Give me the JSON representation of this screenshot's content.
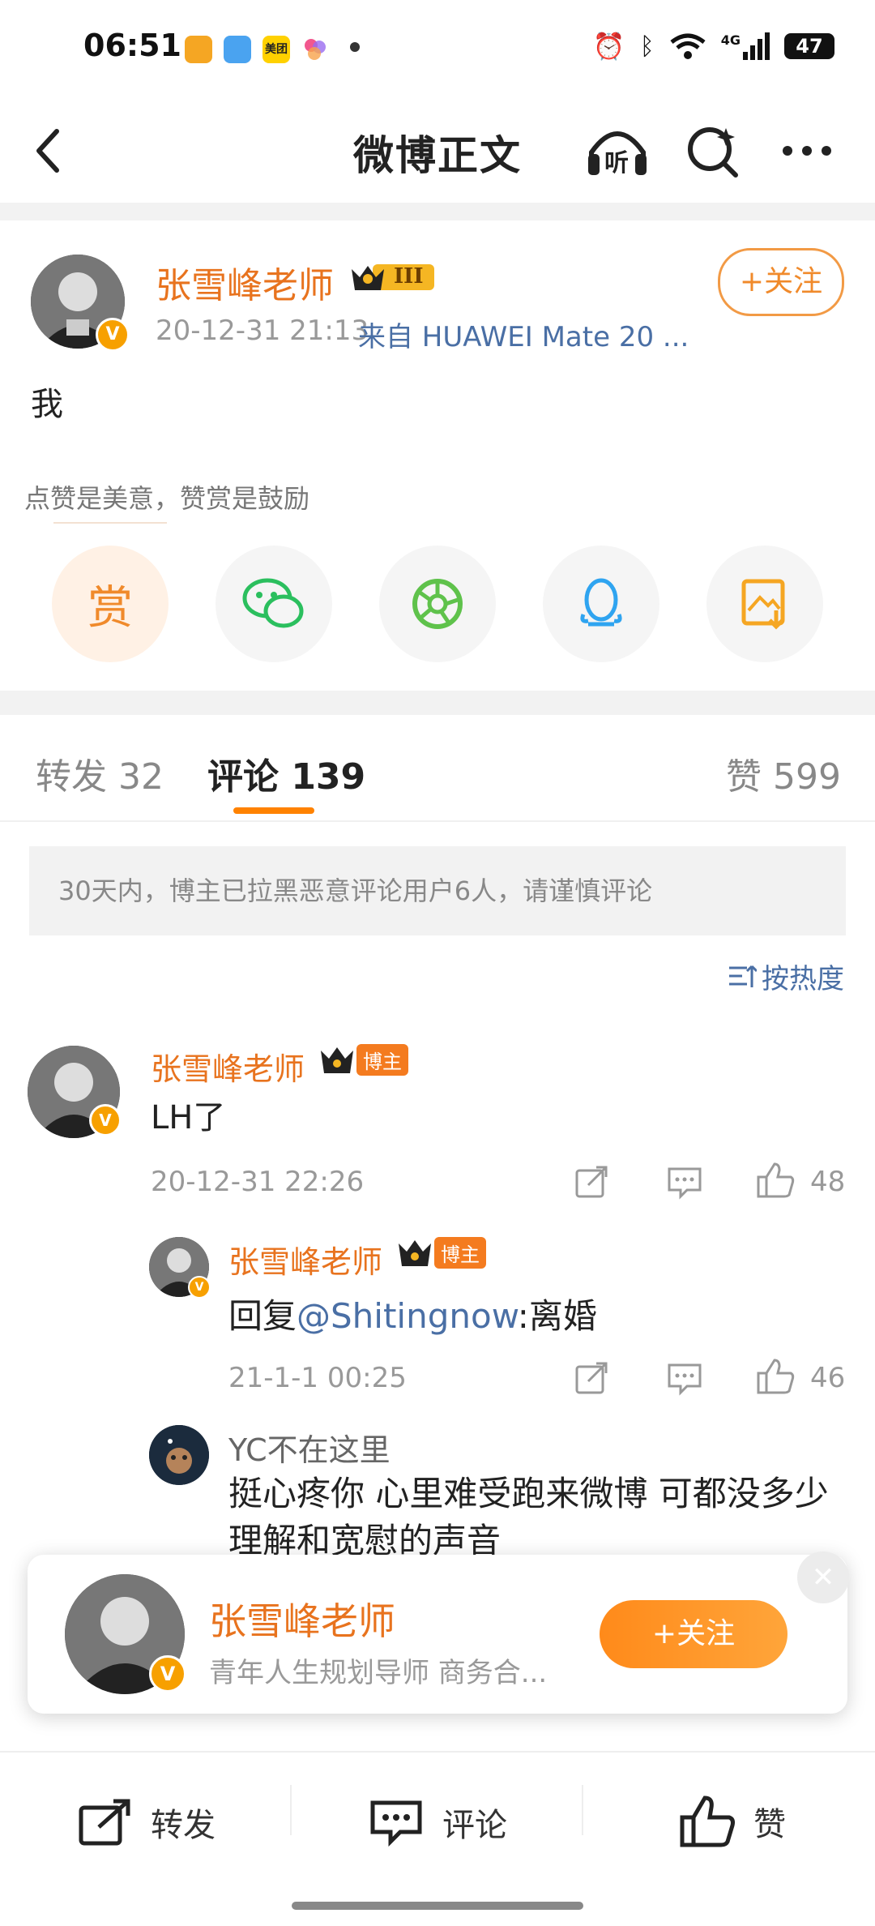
{
  "status_bar": {
    "time": "06:51",
    "battery": "47",
    "network": "4G"
  },
  "nav": {
    "title": "微博正文",
    "listen_label": "听"
  },
  "post": {
    "author": "张雪峰老师",
    "level": "III",
    "timestamp": "20-12-31 21:13",
    "source": "来自 HUAWEI Mate 20 ...",
    "follow_label": "+关注",
    "text": "我",
    "reward_hint": "点赞是美意，赞赏是鼓励",
    "reward_label": "赏"
  },
  "tabs": {
    "repost": "转发 32",
    "comment": "评论 139",
    "like": "赞 599"
  },
  "notice": "30天内，博主已拉黑恶意评论用户6人，请谨慎评论",
  "sort_label": "按热度",
  "comments": [
    {
      "author": "张雪峰老师",
      "badge": "博主",
      "text": "LH了",
      "time": "20-12-31 22:26",
      "likes": "48"
    }
  ],
  "reply": {
    "author": "张雪峰老师",
    "badge": "博主",
    "text_prefix": "回复",
    "mention": "@Shitingnow",
    "text_suffix": ":离婚",
    "time": "21-1-1 00:25",
    "likes": "46"
  },
  "reply2": {
    "author": "YC不在这里",
    "text": "挺心疼你 心里难受跑来微博 可都没多少理解和宽慰的声音"
  },
  "popup": {
    "name": "张雪峰老师",
    "desc": "青年人生规划导师 商务合...",
    "follow_label": "+关注"
  },
  "bottom_bar": {
    "repost": "转发",
    "comment": "评论",
    "like": "赞"
  },
  "colors": {
    "accent": "#ff8200",
    "name": "#e8731e",
    "link": "#4a6fa5"
  }
}
